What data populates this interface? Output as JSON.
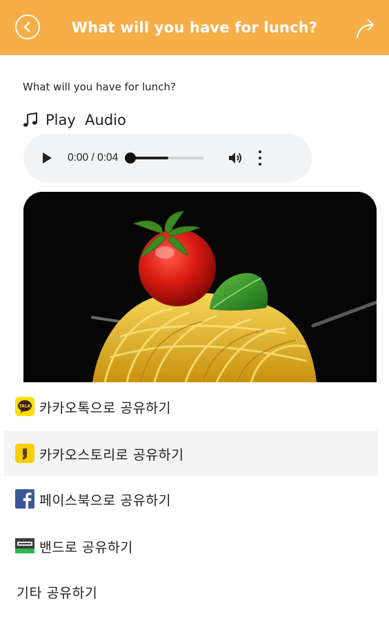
{
  "header": {
    "title": "What will you have for lunch?",
    "background": "#f7ae48"
  },
  "content": {
    "question": "What will you have for lunch?",
    "play_label": "Play  Audio",
    "audio": {
      "time": "0:00 / 0:04",
      "progress_fraction": 0.0,
      "buffered_fraction": 0.52
    },
    "photo": {
      "subject": "spaghetti-with-tomato-and-basil"
    }
  },
  "share_menu": {
    "items": [
      {
        "label": "카카오톡으로 공유하기",
        "icon": "kakaotalk-icon"
      },
      {
        "label": "카카오스토리로 공유하기",
        "icon": "kakaostory-icon"
      },
      {
        "label": "페이스북으로 공유하기",
        "icon": "facebook-icon"
      },
      {
        "label": "밴드로 공유하기",
        "icon": "band-icon"
      },
      {
        "label": "기타 공유하기",
        "icon": ""
      }
    ]
  }
}
